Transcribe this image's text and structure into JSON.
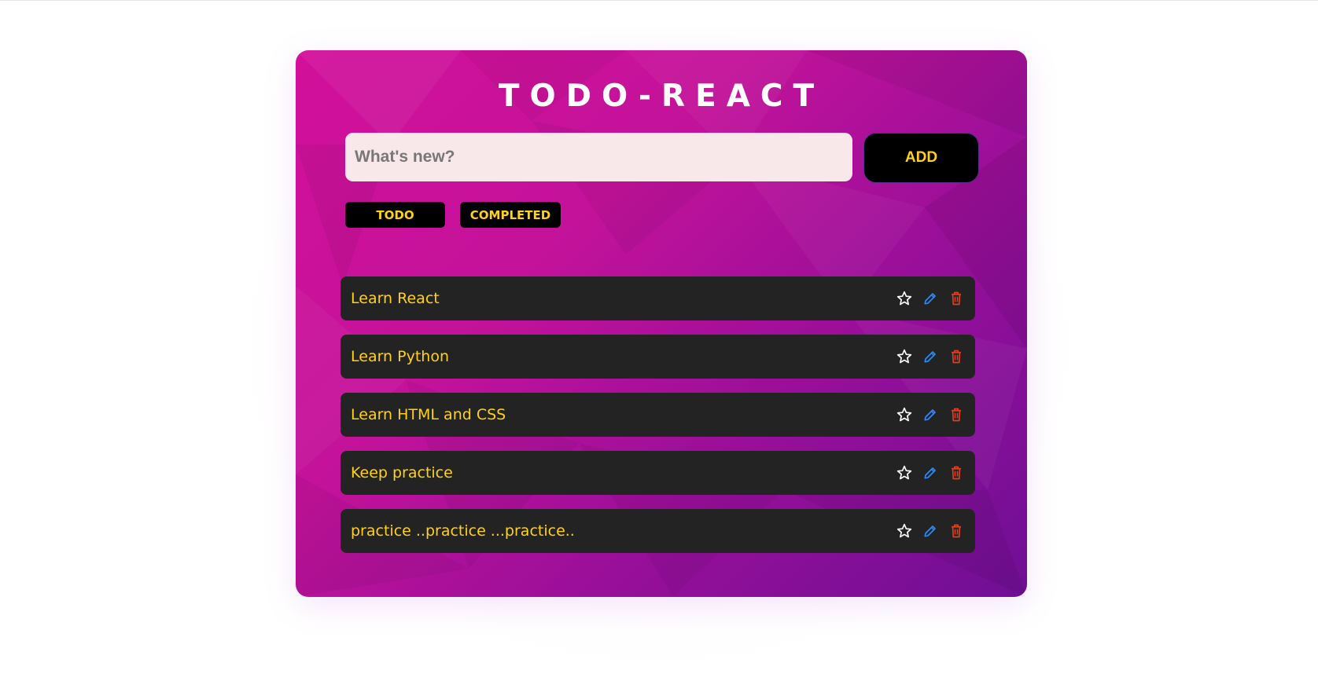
{
  "app": {
    "title": "TODO-REACT"
  },
  "form": {
    "input_value": "",
    "input_placeholder": "What's new?",
    "add_label": "ADD"
  },
  "filters": {
    "todo_label": "TODO",
    "completed_label": "COMPLETED"
  },
  "todos": [
    {
      "text": "Learn React"
    },
    {
      "text": "Learn Python"
    },
    {
      "text": "Learn HTML and CSS"
    },
    {
      "text": "Keep practice"
    },
    {
      "text": "practice ..practice ...practice.."
    }
  ],
  "icons": {
    "favorite": "star-icon",
    "edit": "pencil-icon",
    "delete": "trash-icon"
  },
  "colors": {
    "accent_text": "#ffd21a",
    "card_start": "#d2109a",
    "card_end": "#6e0f95",
    "item_bg": "#232323",
    "edit_icon": "#2f8cf5",
    "delete_icon": "#e0401f",
    "star_icon": "#ffffff"
  }
}
